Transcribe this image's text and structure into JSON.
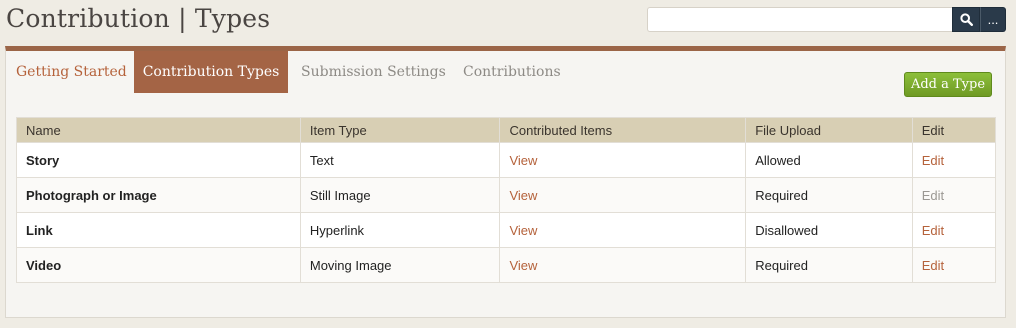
{
  "header": {
    "title": "Contribution | Types",
    "search": {
      "value": "",
      "placeholder": "",
      "submit_icon": "search-icon",
      "advanced_label": "..."
    }
  },
  "tabs": [
    {
      "label": "Getting Started",
      "active": false
    },
    {
      "label": "Contribution Types",
      "active": true
    },
    {
      "label": "Submission Settings",
      "active": false
    },
    {
      "label": "Contributions",
      "active": false
    }
  ],
  "actions": {
    "add_type_label": "Add a Type"
  },
  "table": {
    "columns": [
      "Name",
      "Item Type",
      "Contributed Items",
      "File Upload",
      "Edit"
    ],
    "rows": [
      {
        "name": "Story",
        "item_type": "Text",
        "contributed_items": "View",
        "file_upload": "Allowed",
        "edit": "Edit",
        "edit_enabled": true
      },
      {
        "name": "Photograph or Image",
        "item_type": "Still Image",
        "contributed_items": "View",
        "file_upload": "Required",
        "edit": "Edit",
        "edit_enabled": false
      },
      {
        "name": "Link",
        "item_type": "Hyperlink",
        "contributed_items": "View",
        "file_upload": "Disallowed",
        "edit": "Edit",
        "edit_enabled": true
      },
      {
        "name": "Video",
        "item_type": "Moving Image",
        "contributed_items": "View",
        "file_upload": "Required",
        "edit": "Edit",
        "edit_enabled": true
      }
    ]
  },
  "colors": {
    "accent_brown": "#a46445",
    "link": "#b5623b",
    "table_header_bg": "#d8cfb4",
    "add_button_green": "#7aab2c",
    "search_button": "#2a3a4a"
  }
}
